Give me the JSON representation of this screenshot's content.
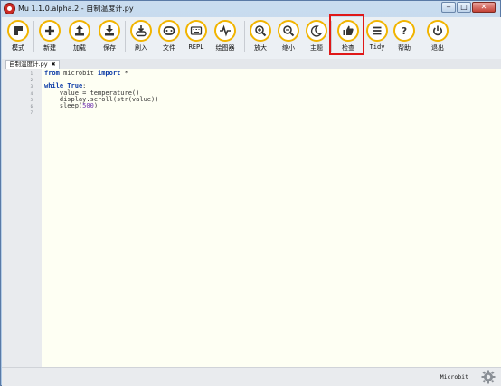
{
  "window": {
    "title": "Mu 1.1.0.alpha.2 - 自制温度计.py",
    "controls": {
      "minimize": "‒",
      "maximize": "□",
      "close": "✕"
    }
  },
  "toolbar": {
    "buttons": [
      {
        "label": "模式",
        "icon": "mode-icon"
      },
      {
        "label": "新建",
        "icon": "new-icon"
      },
      {
        "label": "加载",
        "icon": "load-icon"
      },
      {
        "label": "保存",
        "icon": "save-icon"
      },
      {
        "label": "刷入",
        "icon": "flash-icon"
      },
      {
        "label": "文件",
        "icon": "files-icon"
      },
      {
        "label": "REPL",
        "icon": "repl-icon"
      },
      {
        "label": "绘图器",
        "icon": "plotter-icon"
      },
      {
        "label": "放大",
        "icon": "zoom-in-icon"
      },
      {
        "label": "缩小",
        "icon": "zoom-out-icon"
      },
      {
        "label": "主题",
        "icon": "theme-icon"
      },
      {
        "label": "检查",
        "icon": "check-icon"
      },
      {
        "label": "Tidy",
        "icon": "tidy-icon"
      },
      {
        "label": "帮助",
        "icon": "help-icon"
      },
      {
        "label": "退出",
        "icon": "quit-icon"
      }
    ],
    "highlight_color": "#e01818",
    "accent": "#f1b400"
  },
  "tabs": [
    {
      "label": "自制温度计.py",
      "close": "✖"
    }
  ],
  "editor": {
    "line_numbers": [
      "1",
      "2",
      "3",
      "4",
      "5",
      "6",
      "7"
    ],
    "lines": [
      [
        {
          "t": "from",
          "c": "kw"
        },
        {
          "t": " microbit ",
          "c": "plain"
        },
        {
          "t": "import",
          "c": "kw"
        },
        {
          "t": " *",
          "c": "plain"
        }
      ],
      [],
      [
        {
          "t": "while",
          "c": "kw"
        },
        {
          "t": " ",
          "c": "plain"
        },
        {
          "t": "True",
          "c": "kw"
        },
        {
          "t": ":",
          "c": "plain"
        }
      ],
      [
        {
          "t": "    value = temperature()",
          "c": "plain"
        }
      ],
      [
        {
          "t": "    display.scroll(str(value))",
          "c": "plain"
        }
      ],
      [
        {
          "t": "    sleep(",
          "c": "plain"
        },
        {
          "t": "500",
          "c": "num"
        },
        {
          "t": ")",
          "c": "plain"
        }
      ],
      []
    ]
  },
  "statusbar": {
    "mode": "Microbit",
    "settings_icon": "gear-icon"
  }
}
